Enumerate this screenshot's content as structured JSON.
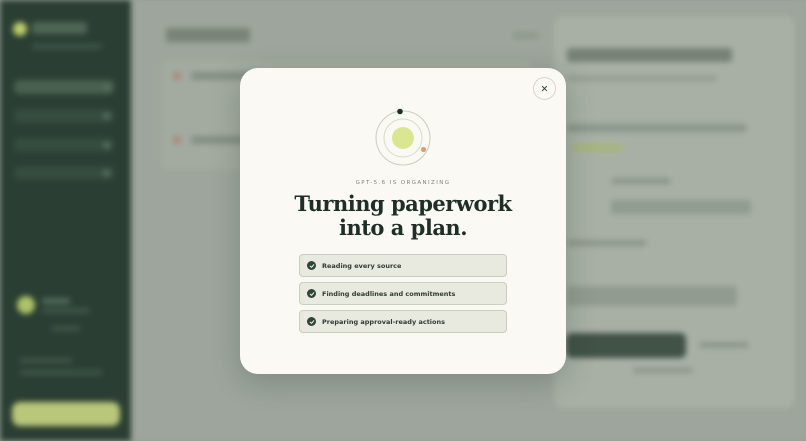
{
  "modal": {
    "status_overline": "GPT-5.6 IS ORGANIZING",
    "headline_line1": "Turning paperwork",
    "headline_line2": "into a plan.",
    "close_icon": "close-icon",
    "tasks": [
      {
        "label": "Reading every source",
        "icon": "check-icon",
        "done": true
      },
      {
        "label": "Finding deadlines and commitments",
        "icon": "check-icon",
        "done": true
      },
      {
        "label": "Preparing approval-ready actions",
        "icon": "check-icon",
        "done": true
      }
    ]
  },
  "colors": {
    "sidebar": "#253a2e",
    "modal_bg": "#fbf9f4",
    "accent_lime": "#d6e68a",
    "accent_orange": "#e39b73",
    "dark_green": "#2f4436"
  }
}
